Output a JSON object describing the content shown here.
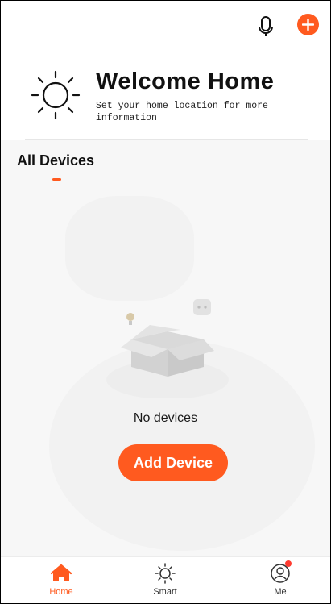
{
  "header": {
    "mic_icon": "microphone-icon",
    "add_icon": "plus-circle-icon"
  },
  "welcome": {
    "title": "Welcome Home",
    "subtitle": "Set your home location for more information",
    "icon": "sun-icon"
  },
  "tabs": {
    "all_devices": "All Devices"
  },
  "empty_state": {
    "message": "No devices",
    "button_label": "Add Device"
  },
  "bottom_nav": {
    "items": [
      {
        "label": "Home",
        "icon": "home-icon",
        "active": true
      },
      {
        "label": "Smart",
        "icon": "sun-outline-icon",
        "active": false
      },
      {
        "label": "Me",
        "icon": "user-icon",
        "active": false,
        "badge": true
      }
    ]
  },
  "colors": {
    "accent": "#ff5a1f",
    "badge": "#ff3b30"
  }
}
